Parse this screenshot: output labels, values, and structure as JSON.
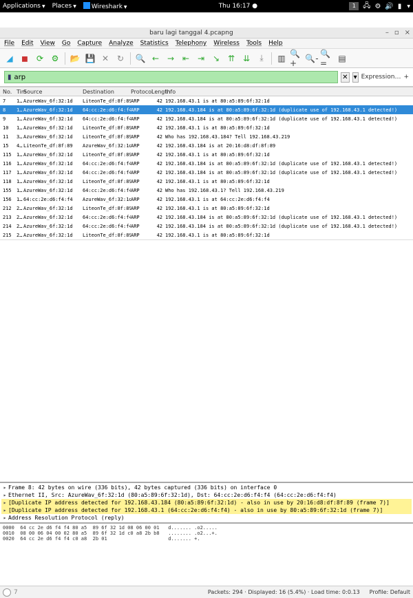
{
  "sysbar": {
    "apps_menu": "Applications",
    "places_menu": "Places",
    "app_name": "Wireshark",
    "clock": "Thu 16:17",
    "clock_dot": "●",
    "workspace": "1"
  },
  "window": {
    "title": "baru lagi  tanggal 4.pcapng",
    "min": "–",
    "max": "▫",
    "close": "×"
  },
  "menu": {
    "file": "File",
    "edit": "Edit",
    "view": "View",
    "go": "Go",
    "capture": "Capture",
    "analyze": "Analyze",
    "statistics": "Statistics",
    "telephony": "Telephony",
    "wireless": "Wireless",
    "tools": "Tools",
    "help": "Help"
  },
  "filter": {
    "value": "arp",
    "clear_btn": "✕",
    "dropdown": "▾",
    "expression": "Expression…",
    "plus": "+"
  },
  "columns": {
    "no": "No.",
    "time": "Tim",
    "source": "Source",
    "destination": "Destination",
    "protocol": "Protocol",
    "length": "Length",
    "info": "Info"
  },
  "packets": [
    {
      "no": "7",
      "time": "1…",
      "src": "AzureWav_6f:32:1d",
      "dst": "LiteonTe_df:8f:89",
      "proto": "ARP",
      "len": "42",
      "info": "192.168.43.1 is at 80:a5:89:6f:32:1d"
    },
    {
      "no": "8",
      "time": "1…",
      "src": "AzureWav_6f:32:1d",
      "dst": "64:cc:2e:d6:f4:f4",
      "proto": "ARP",
      "len": "42",
      "info": "192.168.43.184 is at 80:a5:89:6f:32:1d (duplicate use of 192.168.43.1 detected!)"
    },
    {
      "no": "9",
      "time": "1…",
      "src": "AzureWav_6f:32:1d",
      "dst": "64:cc:2e:d6:f4:f4",
      "proto": "ARP",
      "len": "42",
      "info": "192.168.43.184 is at 80:a5:89:6f:32:1d (duplicate use of 192.168.43.1 detected!)"
    },
    {
      "no": "10",
      "time": "1…",
      "src": "AzureWav_6f:32:1d",
      "dst": "LiteonTe_df:8f:89",
      "proto": "ARP",
      "len": "42",
      "info": "192.168.43.1 is at 80:a5:89:6f:32:1d"
    },
    {
      "no": "11",
      "time": "3…",
      "src": "AzureWav_6f:32:1d",
      "dst": "LiteonTe_df:8f:89",
      "proto": "ARP",
      "len": "42",
      "info": "Who has 192.168.43.184? Tell 192.168.43.219"
    },
    {
      "no": "15",
      "time": "4…",
      "src": "LiteonTe_df:8f:89",
      "dst": "AzureWav_6f:32:1d",
      "proto": "ARP",
      "len": "42",
      "info": "192.168.43.184 is at 20:16:d8:df:8f:89"
    },
    {
      "no": "115",
      "time": "1…",
      "src": "AzureWav_6f:32:1d",
      "dst": "LiteonTe_df:8f:89",
      "proto": "ARP",
      "len": "42",
      "info": "192.168.43.1 is at 80:a5:89:6f:32:1d"
    },
    {
      "no": "116",
      "time": "1…",
      "src": "AzureWav_6f:32:1d",
      "dst": "64:cc:2e:d6:f4:f4",
      "proto": "ARP",
      "len": "42",
      "info": "192.168.43.184 is at 80:a5:89:6f:32:1d (duplicate use of 192.168.43.1 detected!)"
    },
    {
      "no": "117",
      "time": "1…",
      "src": "AzureWav_6f:32:1d",
      "dst": "64:cc:2e:d6:f4:f4",
      "proto": "ARP",
      "len": "42",
      "info": "192.168.43.184 is at 80:a5:89:6f:32:1d (duplicate use of 192.168.43.1 detected!)"
    },
    {
      "no": "118",
      "time": "1…",
      "src": "AzureWav_6f:32:1d",
      "dst": "LiteonTe_df:8f:89",
      "proto": "ARP",
      "len": "42",
      "info": "192.168.43.1 is at 80:a5:89:6f:32:1d"
    },
    {
      "no": "155",
      "time": "1…",
      "src": "AzureWav_6f:32:1d",
      "dst": "64:cc:2e:d6:f4:f4",
      "proto": "ARP",
      "len": "42",
      "info": "Who has 192.168.43.1? Tell 192.168.43.219"
    },
    {
      "no": "156",
      "time": "1…",
      "src": "64:cc:2e:d6:f4:f4",
      "dst": "AzureWav_6f:32:1d",
      "proto": "ARP",
      "len": "42",
      "info": "192.168.43.1 is at 64:cc:2e:d6:f4:f4"
    },
    {
      "no": "212",
      "time": "2…",
      "src": "AzureWav_6f:32:1d",
      "dst": "LiteonTe_df:8f:89",
      "proto": "ARP",
      "len": "42",
      "info": "192.168.43.1 is at 80:a5:89:6f:32:1d"
    },
    {
      "no": "213",
      "time": "2…",
      "src": "AzureWav_6f:32:1d",
      "dst": "64:cc:2e:d6:f4:f4",
      "proto": "ARP",
      "len": "42",
      "info": "192.168.43.184 is at 80:a5:89:6f:32:1d (duplicate use of 192.168.43.1 detected!)"
    },
    {
      "no": "214",
      "time": "2…",
      "src": "AzureWav_6f:32:1d",
      "dst": "64:cc:2e:d6:f4:f4",
      "proto": "ARP",
      "len": "42",
      "info": "192.168.43.184 is at 80:a5:89:6f:32:1d (duplicate use of 192.168.43.1 detected!)"
    },
    {
      "no": "215",
      "time": "2…",
      "src": "AzureWav_6f:32:1d",
      "dst": "LiteonTe_df:8f:89",
      "proto": "ARP",
      "len": "42",
      "info": "192.168.43.1 is at 80:a5:89:6f:32:1d"
    }
  ],
  "selected_row": 1,
  "details": [
    {
      "text": "Frame 8: 42 bytes on wire (336 bits), 42 bytes captured (336 bits) on interface 0",
      "warn": false
    },
    {
      "text": "Ethernet II, Src: AzureWav_6f:32:1d (80:a5:89:6f:32:1d), Dst: 64:cc:2e:d6:f4:f4 (64:cc:2e:d6:f4:f4)",
      "warn": false
    },
    {
      "text": "[Duplicate IP address detected for 192.168.43.184 (80:a5:89:6f:32:1d) - also in use by 20:16:d8:df:8f:89 (frame 7)]",
      "warn": true
    },
    {
      "text": "[Duplicate IP address detected for 192.168.43.1 (64:cc:2e:d6:f4:f4) - also in use by 80:a5:89:6f:32:1d (frame 7)]",
      "warn": true
    },
    {
      "text": "Address Resolution Protocol (reply)",
      "warn": false
    }
  ],
  "hex": {
    "l0": "0000  64 cc 2e d6 f4 f4 80 a5  89 6f 32 1d 08 06 00 01   d....... .o2.....",
    "l1": "0010  08 00 06 04 00 02 80 a5  89 6f 32 1d c0 a8 2b b8   ........ .o2...+.",
    "l2": "0020  64 cc 2e d6 f4 f4 c0 a8  2b 01                     d....... +."
  },
  "status": {
    "ready": "7",
    "packets": "Packets: 294 · Displayed: 16 (5.4%) · Load time: 0:0.13",
    "profile": "Profile: Default"
  }
}
